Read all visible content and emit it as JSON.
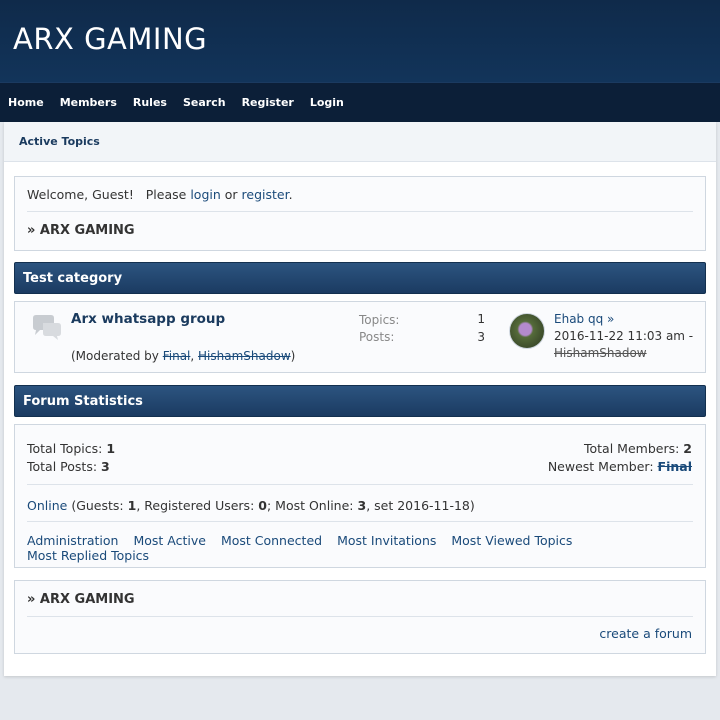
{
  "site": {
    "title": "ARX GAMING"
  },
  "nav": {
    "items": [
      {
        "label": "Home"
      },
      {
        "label": "Members"
      },
      {
        "label": "Rules"
      },
      {
        "label": "Search"
      },
      {
        "label": "Register"
      },
      {
        "label": "Login"
      }
    ]
  },
  "subbar": {
    "active_topics": "Active Topics"
  },
  "welcome": {
    "prefix": "Welcome, Guest!   Please",
    "login": "login",
    "or": "or",
    "register": "register",
    "suffix": "."
  },
  "breadcrumb": {
    "label": "» ARX GAMING"
  },
  "category": {
    "title": "Test category",
    "forum": {
      "name": "Arx whatsapp group",
      "moderated_prefix": "(Moderated by",
      "moderators": [
        "Final",
        "HishamShadow"
      ],
      "moderated_suffix": ")",
      "topics_label": "Topics:",
      "topics": "1",
      "posts_label": "Posts:",
      "posts": "3",
      "last_post": {
        "title": "Ehab qq",
        "arrow": "»",
        "date": "2016-11-22 11:03 am -",
        "user": "HishamShadow"
      }
    }
  },
  "stats": {
    "title": "Forum Statistics",
    "total_topics_label": "Total Topics:",
    "total_topics": "1",
    "total_posts_label": "Total Posts:",
    "total_posts": "3",
    "total_members_label": "Total Members:",
    "total_members": "2",
    "newest_member_label": "Newest Member:",
    "newest_member": "Final",
    "online": {
      "link": "Online",
      "guests_label": "(Guests:",
      "guests": "1",
      "registered_label": ", Registered Users:",
      "registered": "0",
      "most_label": "; Most Online:",
      "most": "3",
      "set_text": ", set 2016-11-18)"
    },
    "links": [
      {
        "label": "Administration"
      },
      {
        "label": "Most Active"
      },
      {
        "label": "Most Connected"
      },
      {
        "label": "Most Invitations"
      },
      {
        "label": "Most Viewed Topics"
      },
      {
        "label": "Most Replied Topics"
      }
    ]
  },
  "footer": {
    "breadcrumb": "» ARX GAMING",
    "create_forum": "create a forum"
  }
}
